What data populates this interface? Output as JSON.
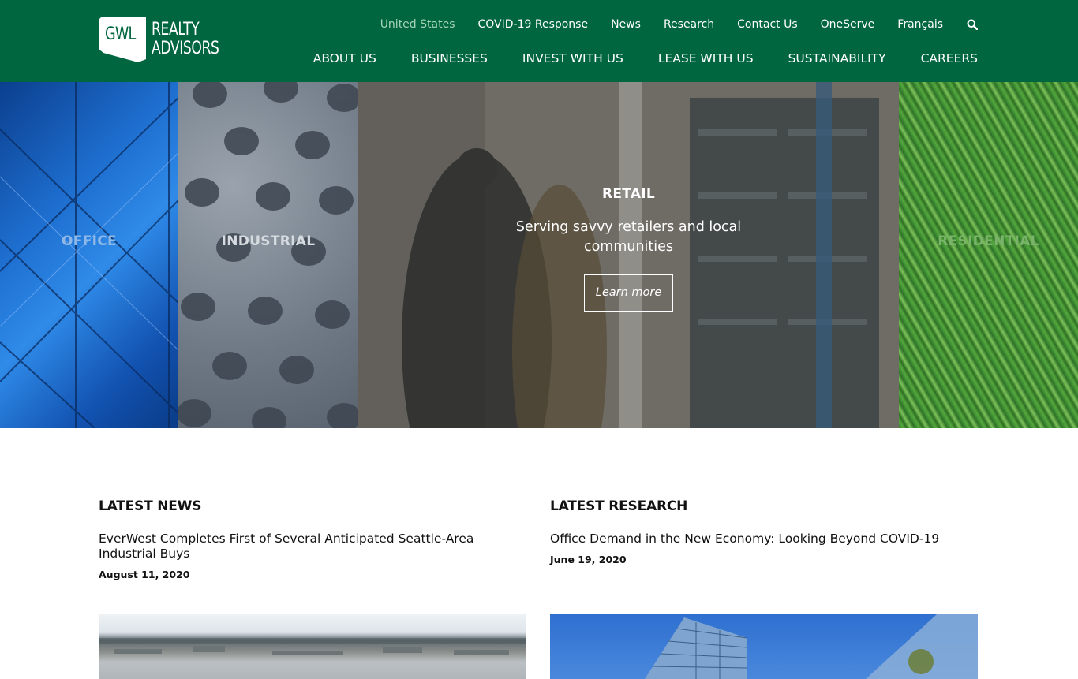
{
  "brand": {
    "badge": "GWL",
    "line1": "REALTY",
    "line2": "ADVISORS"
  },
  "utility_nav": {
    "region": "United States",
    "items": [
      "COVID-19 Response",
      "News",
      "Research",
      "Contact Us",
      "OneServe",
      "Français"
    ],
    "search_icon": "search-icon"
  },
  "main_nav": {
    "items": [
      "ABOUT US",
      "BUSINESSES",
      "INVEST WITH US",
      "LEASE WITH US",
      "SUSTAINABILITY",
      "CAREERS"
    ]
  },
  "hero": {
    "panels": [
      "OFFICE",
      "INDUSTRIAL",
      "RETAIL",
      "RESIDENTIAL"
    ],
    "active": {
      "title": "RETAIL",
      "subtitle": "Serving savvy retailers and local communities",
      "cta": "Learn more"
    }
  },
  "news": {
    "heading": "LATEST NEWS",
    "title": "EverWest Completes First of Several Anticipated Seattle-Area Industrial Buys",
    "date": "August 11, 2020"
  },
  "research": {
    "heading": "LATEST RESEARCH",
    "title": "Office Demand in the New Economy: Looking Beyond COVID-19",
    "date": "June 19, 2020"
  },
  "colors": {
    "header_green": "#00663f",
    "active_region": "#a7d4b7",
    "text": "#111111"
  }
}
